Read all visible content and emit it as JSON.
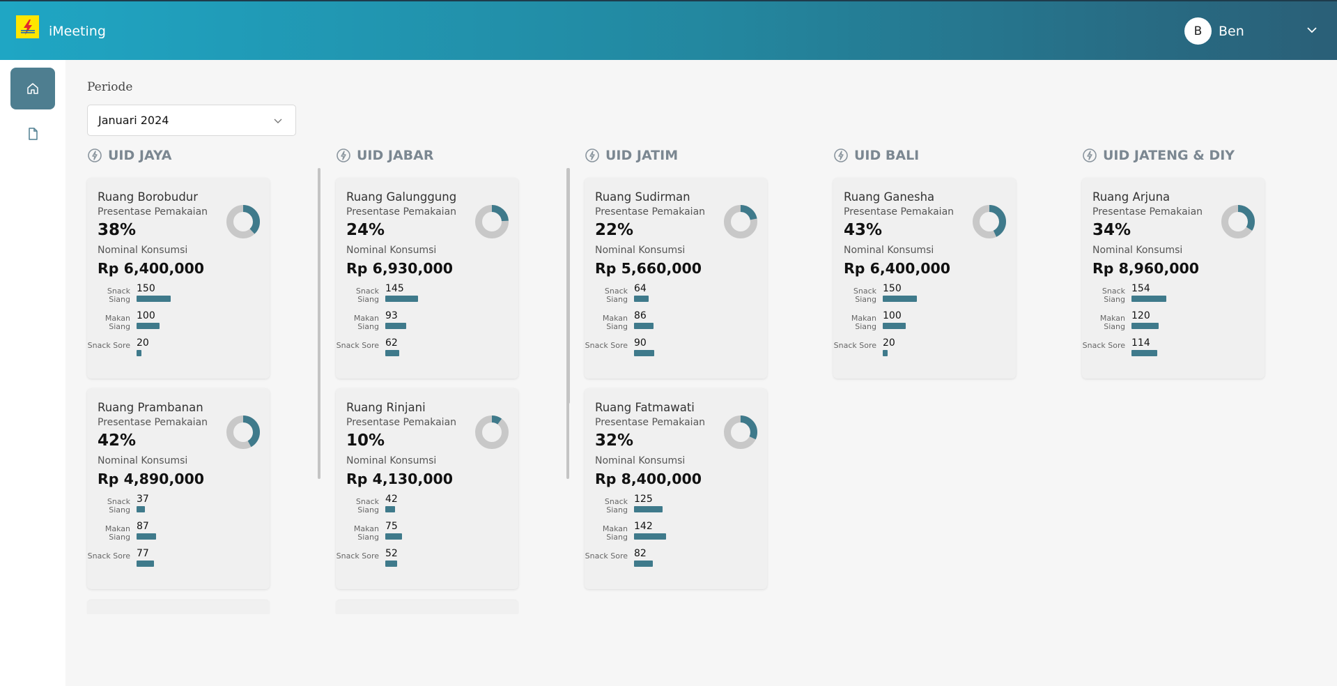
{
  "app": {
    "title": "iMeeting"
  },
  "user": {
    "initial": "B",
    "name": "Ben"
  },
  "colors": {
    "accent": "#3f7a8b",
    "header_from": "#1fa6c4",
    "header_to": "#2a5f77",
    "donut_track": "#c8c8c8"
  },
  "icons": {
    "home": "home-icon",
    "document": "document-icon",
    "region": "lightning-icon",
    "dropdown": "chevron-down-icon"
  },
  "periode": {
    "label": "Periode",
    "value": "Januari 2024"
  },
  "card_labels": {
    "usage": "Presentase Pemakaian",
    "consumption": "Nominal Konsumsi"
  },
  "bar_max": 160,
  "columns": [
    {
      "name": "UID JAYA",
      "cards": [
        {
          "room": "Ruang Borobudur",
          "percent": 38,
          "percent_text": "38%",
          "nominal": "Rp 6,400,000",
          "items": [
            {
              "label": "Snack Siang",
              "value": 150
            },
            {
              "label": "Makan Siang",
              "value": 100
            },
            {
              "label": "Snack Sore",
              "value": 20
            }
          ]
        },
        {
          "room": "Ruang Prambanan",
          "percent": 42,
          "percent_text": "42%",
          "nominal": "Rp 4,890,000",
          "items": [
            {
              "label": "Snack Siang",
              "value": 37
            },
            {
              "label": "Makan Siang",
              "value": 87
            },
            {
              "label": "Snack Sore",
              "value": 77
            }
          ]
        }
      ],
      "has_more": true
    },
    {
      "name": "UID JABAR",
      "cards": [
        {
          "room": "Ruang Galunggung",
          "percent": 24,
          "percent_text": "24%",
          "nominal": "Rp 6,930,000",
          "items": [
            {
              "label": "Snack Siang",
              "value": 145
            },
            {
              "label": "Makan Siang",
              "value": 93
            },
            {
              "label": "Snack Sore",
              "value": 62
            }
          ]
        },
        {
          "room": "Ruang Rinjani",
          "percent": 10,
          "percent_text": "10%",
          "nominal": "Rp 4,130,000",
          "items": [
            {
              "label": "Snack Siang",
              "value": 42
            },
            {
              "label": "Makan Siang",
              "value": 75
            },
            {
              "label": "Snack Sore",
              "value": 52
            }
          ]
        }
      ],
      "has_more": true
    },
    {
      "name": "UID JATIM",
      "cards": [
        {
          "room": "Ruang Sudirman",
          "percent": 22,
          "percent_text": "22%",
          "nominal": "Rp 5,660,000",
          "items": [
            {
              "label": "Snack Siang",
              "value": 64
            },
            {
              "label": "Makan Siang",
              "value": 86
            },
            {
              "label": "Snack Sore",
              "value": 90
            }
          ]
        },
        {
          "room": "Ruang Fatmawati",
          "percent": 32,
          "percent_text": "32%",
          "nominal": "Rp 8,400,000",
          "items": [
            {
              "label": "Snack Siang",
              "value": 125
            },
            {
              "label": "Makan Siang",
              "value": 142
            },
            {
              "label": "Snack Sore",
              "value": 82
            }
          ]
        }
      ],
      "has_more": false
    },
    {
      "name": "UID BALI",
      "cards": [
        {
          "room": "Ruang Ganesha",
          "percent": 43,
          "percent_text": "43%",
          "nominal": "Rp 6,400,000",
          "items": [
            {
              "label": "Snack Siang",
              "value": 150
            },
            {
              "label": "Makan Siang",
              "value": 100
            },
            {
              "label": "Snack Sore",
              "value": 20
            }
          ]
        }
      ],
      "has_more": false
    },
    {
      "name": "UID JATENG & DIY",
      "cards": [
        {
          "room": "Ruang Arjuna",
          "percent": 34,
          "percent_text": "34%",
          "nominal": "Rp 8,960,000",
          "items": [
            {
              "label": "Snack Siang",
              "value": 154
            },
            {
              "label": "Makan Siang",
              "value": 120
            },
            {
              "label": "Snack Sore",
              "value": 114
            }
          ]
        }
      ],
      "has_more": false
    }
  ]
}
